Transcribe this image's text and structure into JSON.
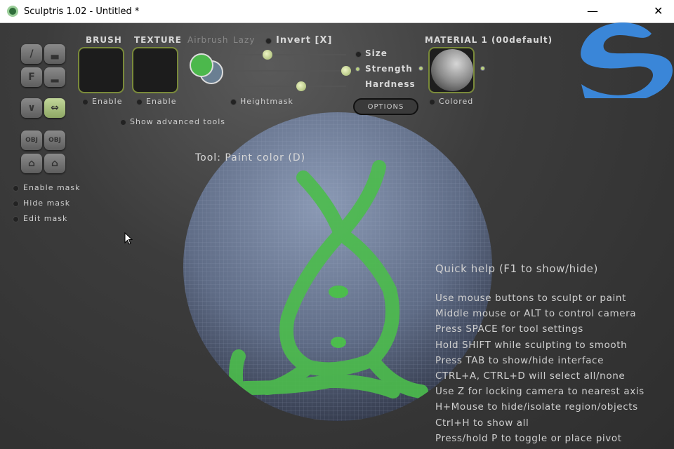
{
  "window": {
    "title": "Sculptris 1.02 - Untitled *",
    "minimize": "—",
    "close": "✕"
  },
  "toolbar": {
    "brush_label": "BRUSH",
    "texture_label": "TEXTURE",
    "airbrush_label": "Airbrush",
    "lazy_label": "Lazy",
    "invert_label": "Invert [X]",
    "brush_enable": "Enable",
    "texture_enable": "Enable",
    "show_advanced": "Show advanced tools",
    "heightmask": "Heightmask",
    "size_label": "Size",
    "strength_label": "Strength",
    "hardness_label": "Hardness",
    "options_label": "OPTIONS",
    "material_label": "MATERIAL 1 (00default)",
    "colored_label": "Colored",
    "sliders": {
      "size": 0.3,
      "strength": 1.0,
      "hardness": 0.6
    },
    "primary_color": "#4cb84c",
    "secondary_color": "#6a7f92"
  },
  "left_tools": {
    "flatten_label": "F",
    "enable_mask": "Enable mask",
    "hide_mask": "Hide mask",
    "edit_mask": "Edit mask",
    "import_obj": "OBJ",
    "export_obj": "OBJ"
  },
  "viewport": {
    "tool_label": "Tool: Paint color (D)"
  },
  "quick_help": {
    "title": "Quick help (F1 to show/hide)",
    "lines": [
      "Use mouse buttons to sculpt or paint",
      "Middle mouse or ALT to control camera",
      "Press SPACE for tool settings",
      "Hold SHIFT while sculpting to smooth",
      "Press TAB to show/hide interface",
      "CTRL+A, CTRL+D will select all/none",
      "Use Z for locking camera to nearest axis",
      "H+Mouse to hide/isolate region/objects",
      "Ctrl+H to show all",
      "Press/hold P to toggle or place pivot"
    ]
  }
}
